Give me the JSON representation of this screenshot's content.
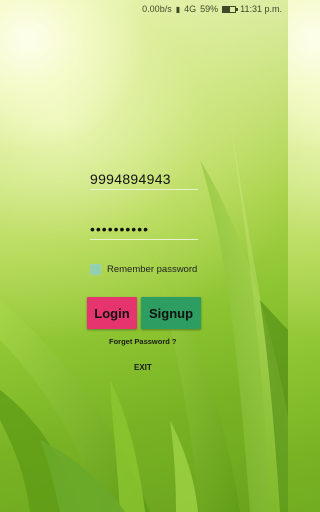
{
  "status_bar": {
    "speed": "0.00b/s",
    "network": "4G",
    "battery_percent": "59%",
    "battery_level": 0.59,
    "time": "11:31 p.m."
  },
  "login_form": {
    "phone_value": "9994894943",
    "password_value": "••••••••••",
    "remember_label": "Remember password",
    "remember_checked": true,
    "login_label": "Login",
    "signup_label": "Signup",
    "forget_label": "Forget Password ?",
    "exit_label": "EXIT"
  },
  "colors": {
    "login_button": "#e6346f",
    "signup_button": "#2e9d62",
    "checkbox": "#8fd0b0"
  },
  "icons": {
    "status": [
      "signal-icon",
      "battery-icon"
    ]
  }
}
